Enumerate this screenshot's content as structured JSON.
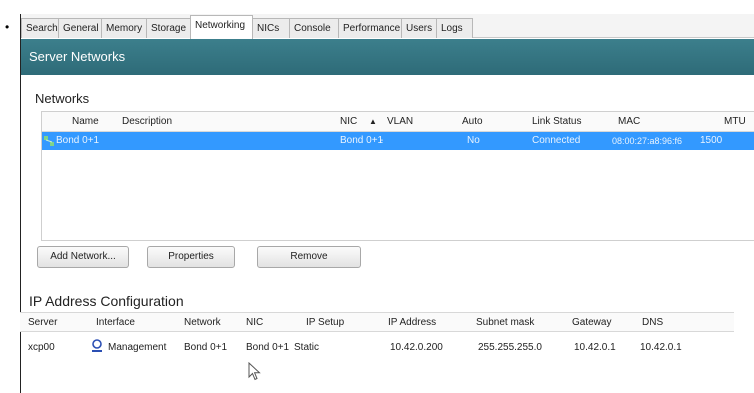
{
  "tabs": [
    "Search",
    "General",
    "Memory",
    "Storage",
    "Networking",
    "NICs",
    "Console",
    "Performance",
    "Users",
    "Logs"
  ],
  "active_tab": "Networking",
  "banner": {
    "title": "Server Networks"
  },
  "networks": {
    "title": "Networks",
    "columns": [
      "Name",
      "Description",
      "NIC",
      "▲",
      "VLAN",
      "Auto",
      "Link Status",
      "MAC",
      "MTU"
    ],
    "rows": [
      {
        "name": "Bond 0+1",
        "description": "",
        "nic": "Bond 0+1",
        "vlan": "-",
        "auto": "No",
        "link_status": "Connected",
        "mac": "08:00:27:a8:96:f6",
        "mtu": "1500",
        "selected": true
      }
    ],
    "selection_color": "#3399ff"
  },
  "buttons": {
    "add_network": "Add Network...",
    "properties": "Properties",
    "remove": "Remove"
  },
  "ip_config": {
    "title": "IP Address Configuration",
    "columns": [
      "Server",
      "Interface",
      "Network",
      "NIC",
      "IP Setup",
      "IP Address",
      "Subnet mask",
      "Gateway",
      "DNS"
    ],
    "rows": [
      {
        "server": "xcp00",
        "interface": "Management",
        "network": "Bond 0+1",
        "nic": "Bond 0+1",
        "ip_setup": "Static",
        "ip_address": "10.42.0.200",
        "subnet_mask": "255.255.255.0",
        "gateway": "10.42.0.1",
        "dns": "10.42.0.1"
      }
    ]
  },
  "colors": {
    "banner": "#3c7f8c",
    "selection": "#3399ff"
  },
  "icons": {
    "network_row": "network-icon",
    "interface": "management-interface-icon",
    "sort": "sort-ascending-icon",
    "cursor": "mouse-pointer-icon"
  }
}
